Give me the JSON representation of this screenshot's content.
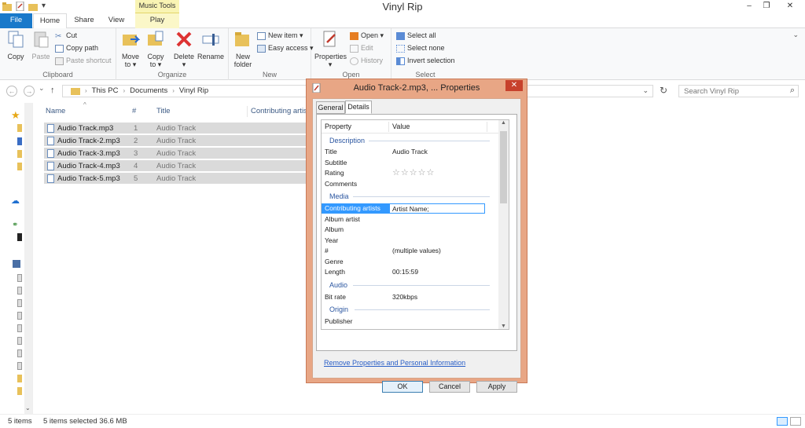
{
  "window": {
    "title": "Vinyl Rip",
    "context_tab": "Music Tools",
    "controls": [
      "–",
      "❐",
      "✕"
    ]
  },
  "ribbon": {
    "tabs": [
      "File",
      "Home",
      "Share",
      "View",
      "Play"
    ],
    "clipboard": {
      "label": "Clipboard",
      "copy": "Copy",
      "paste": "Paste",
      "cut": "Cut",
      "copy_path": "Copy path",
      "paste_shortcut": "Paste shortcut"
    },
    "organize": {
      "label": "Organize",
      "move_to": "Move",
      "move_to_2": "to ▾",
      "copy_to": "Copy",
      "copy_to_2": "to ▾",
      "delete": "Delete",
      "delete_2": "▾",
      "rename": "Rename"
    },
    "new": {
      "label": "New",
      "new_folder": "New",
      "new_folder_2": "folder",
      "new_item": "New item ▾",
      "easy_access": "Easy access ▾"
    },
    "open": {
      "label": "Open",
      "properties": "Properties",
      "properties_2": "▾",
      "open": "Open ▾",
      "edit": "Edit",
      "history": "History"
    },
    "select": {
      "label": "Select",
      "select_all": "Select all",
      "select_none": "Select none",
      "invert_selection": "Invert selection"
    }
  },
  "navigation": {
    "back": "←",
    "forward": "→",
    "recent": "⌄",
    "up": "↑",
    "breadcrumb": [
      "This PC",
      "Documents",
      "Vinyl Rip"
    ],
    "search_placeholder": "Search Vinyl Rip"
  },
  "file_list": {
    "columns": [
      "Name",
      "#",
      "Title",
      "Contributing artists"
    ],
    "sort_indicator": "^",
    "rows": [
      {
        "name": "Audio Track.mp3",
        "num": "1",
        "title": "Audio Track"
      },
      {
        "name": "Audio Track-2.mp3",
        "num": "2",
        "title": "Audio Track"
      },
      {
        "name": "Audio Track-3.mp3",
        "num": "3",
        "title": "Audio Track"
      },
      {
        "name": "Audio Track-4.mp3",
        "num": "4",
        "title": "Audio Track"
      },
      {
        "name": "Audio Track-5.mp3",
        "num": "5",
        "title": "Audio Track"
      }
    ]
  },
  "status": {
    "items": "5 items",
    "selected": "5 items selected  36.6 MB"
  },
  "dialog": {
    "title": "Audio Track-2.mp3, ... Properties",
    "close": "✕",
    "tabs": [
      "General",
      "Details"
    ],
    "header": {
      "property": "Property",
      "value": "Value"
    },
    "sections": {
      "description": "Description",
      "media": "Media",
      "audio": "Audio",
      "origin": "Origin"
    },
    "props": {
      "title_k": "Title",
      "title_v": "Audio Track",
      "subtitle_k": "Subtitle",
      "rating_k": "Rating",
      "comments_k": "Comments",
      "contrib_k": "Contributing artists",
      "contrib_v": "Artist Name;",
      "album_artist_k": "Album artist",
      "album_k": "Album",
      "year_k": "Year",
      "num_k": "#",
      "num_v": "(multiple values)",
      "genre_k": "Genre",
      "length_k": "Length",
      "length_v": "00:15:59",
      "bitrate_k": "Bit rate",
      "bitrate_v": "320kbps",
      "publisher_k": "Publisher"
    },
    "rating_stars": 0,
    "remove_link": "Remove Properties and Personal Information",
    "buttons": {
      "ok": "OK",
      "cancel": "Cancel",
      "apply": "Apply"
    }
  },
  "colors": {
    "file_tab": "#1979ca",
    "dialog_frame": "#e8a685",
    "selection": "#3399ff",
    "section_text": "#2a55a0"
  }
}
